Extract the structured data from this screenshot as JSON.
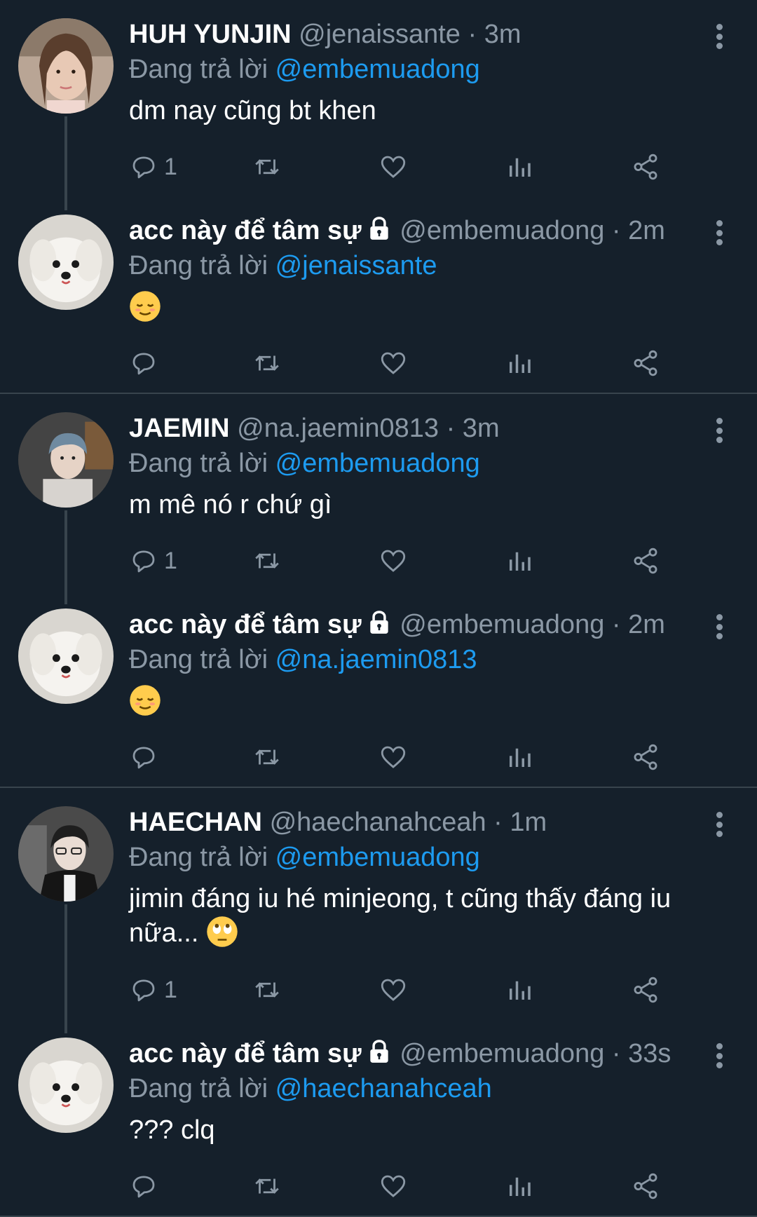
{
  "replying_prefix": "Đang trả lời",
  "threads": [
    {
      "tweets": [
        {
          "name": "HUH YUNJIN",
          "handle": "@jenaissante",
          "time": "· 3m",
          "locked": false,
          "reply_to": "@embemuadong",
          "text": "dm nay cũng bt khen",
          "emoji": "",
          "reply_count": "1",
          "avatar": "girl-avatar"
        },
        {
          "name": "acc này để tâm sự",
          "handle": "@embemuadong",
          "time": "· 2m",
          "locked": true,
          "reply_to": "@jenaissante",
          "text": "",
          "emoji": "relieved-face",
          "reply_count": "",
          "avatar": "white-dog-avatar"
        }
      ]
    },
    {
      "tweets": [
        {
          "name": "JAEMIN",
          "handle": "@na.jaemin0813",
          "time": "· 3m",
          "locked": false,
          "reply_to": "@embemuadong",
          "text": "m mê nó r chứ gì",
          "emoji": "",
          "reply_count": "1",
          "avatar": "boy-avatar-jaemin"
        },
        {
          "name": "acc này để tâm sự",
          "handle": "@embemuadong",
          "time": "· 2m",
          "locked": true,
          "reply_to": "@na.jaemin0813",
          "text": "",
          "emoji": "relieved-face",
          "reply_count": "",
          "avatar": "white-dog-avatar"
        }
      ]
    },
    {
      "tweets": [
        {
          "name": "HAECHAN",
          "handle": "@haechanahceah",
          "time": "· 1m",
          "locked": false,
          "reply_to": "@embemuadong",
          "text": "jimin đáng iu hé minjeong, t cũng thấy đáng iu nữa...",
          "emoji": "rolling-eyes-face",
          "reply_count": "1",
          "avatar": "boy-avatar-haechan"
        },
        {
          "name": "acc này để tâm sự",
          "handle": "@embemuadong",
          "time": "· 33s",
          "locked": true,
          "reply_to": "@haechanahceah",
          "text": "??? clq",
          "emoji": "",
          "reply_count": "",
          "avatar": "white-dog-avatar"
        }
      ]
    }
  ],
  "colors": {
    "background": "#15202b",
    "secondary_text": "#8b98a5",
    "mention": "#1d9bf0",
    "divider": "#38444d"
  }
}
